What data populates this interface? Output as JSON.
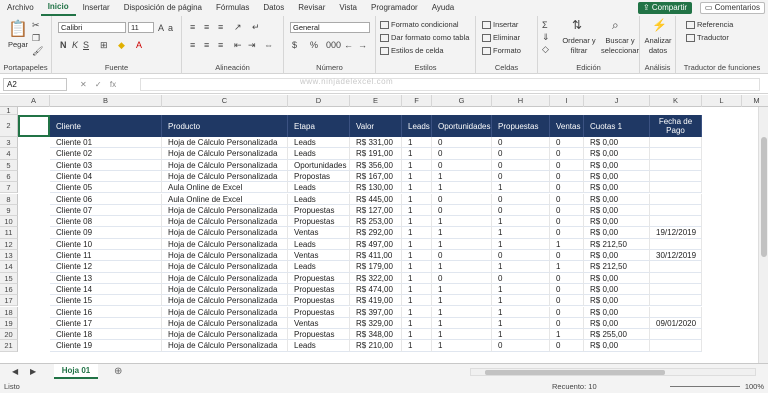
{
  "tabs": [
    "Archivo",
    "Inicio",
    "Insertar",
    "Disposición de página",
    "Fórmulas",
    "Datos",
    "Revisar",
    "Vista",
    "Programador",
    "Ayuda"
  ],
  "active_tab": "Inicio",
  "share_label": "Compartir",
  "comments_label": "Comentarios",
  "ribbon": {
    "clipboard": {
      "paste": "Pegar",
      "label": "Portapapeles"
    },
    "font": {
      "family": "Calibri",
      "size": "11",
      "label": "Fuente"
    },
    "alignment": {
      "label": "Alineación"
    },
    "number": {
      "format": "General",
      "label": "Número"
    },
    "styles": {
      "cond": "Formato condicional",
      "table": "Dar formato como tabla",
      "cell": "Estilos de celda",
      "label": "Estilos"
    },
    "cells": {
      "insert": "Insertar",
      "delete": "Eliminar",
      "format": "Formato",
      "label": "Celdas"
    },
    "editing": {
      "sort": "Ordenar y filtrar",
      "find": "Buscar y seleccionar",
      "label": "Edición"
    },
    "analysis": {
      "analyze": "Analizar datos",
      "label": "Análisis"
    },
    "translator": {
      "ref": "Referencia",
      "trans": "Traductor",
      "label": "Traductor de funciones"
    }
  },
  "name_box": "A2",
  "fx": "✕ ✓ fx",
  "watermark": "www.ninjadelexcel.com",
  "columns": [
    "A",
    "B",
    "C",
    "D",
    "E",
    "F",
    "G",
    "H",
    "I",
    "J",
    "K",
    "L",
    "M"
  ],
  "headers": [
    "Cliente",
    "Producto",
    "Etapa",
    "Valor",
    "Leads",
    "Oportunidades",
    "Propuestas",
    "Ventas",
    "Cuotas 1",
    "Fecha de Pago"
  ],
  "rows": [
    [
      "Cliente 01",
      "Hoja de Cálculo Personalizada",
      "Leads",
      "R$ 331,00",
      "1",
      "0",
      "0",
      "0",
      "R$ 0,00",
      ""
    ],
    [
      "Cliente 02",
      "Hoja de Cálculo Personalizada",
      "Leads",
      "R$ 191,00",
      "1",
      "0",
      "0",
      "0",
      "R$ 0,00",
      ""
    ],
    [
      "Cliente 03",
      "Hoja de Cálculo Personalizada",
      "Oportunidades",
      "R$ 356,00",
      "1",
      "0",
      "0",
      "0",
      "R$ 0,00",
      ""
    ],
    [
      "Cliente 04",
      "Hoja de Cálculo Personalizada",
      "Propostas",
      "R$ 167,00",
      "1",
      "1",
      "0",
      "0",
      "R$ 0,00",
      ""
    ],
    [
      "Cliente 05",
      "Aula Online de Excel",
      "Leads",
      "R$ 130,00",
      "1",
      "1",
      "1",
      "0",
      "R$ 0,00",
      ""
    ],
    [
      "Cliente 06",
      "Aula Online de Excel",
      "Leads",
      "R$ 445,00",
      "1",
      "0",
      "0",
      "0",
      "R$ 0,00",
      ""
    ],
    [
      "Cliente 07",
      "Hoja de Cálculo Personalizada",
      "Propuestas",
      "R$ 127,00",
      "1",
      "0",
      "0",
      "0",
      "R$ 0,00",
      ""
    ],
    [
      "Cliente 08",
      "Hoja de Cálculo Personalizada",
      "Propuestas",
      "R$ 253,00",
      "1",
      "1",
      "1",
      "0",
      "R$ 0,00",
      ""
    ],
    [
      "Cliente 09",
      "Hoja de Cálculo Personalizada",
      "Ventas",
      "R$ 292,00",
      "1",
      "1",
      "1",
      "0",
      "R$ 0,00",
      "19/12/2019"
    ],
    [
      "Cliente 10",
      "Hoja de Cálculo Personalizada",
      "Leads",
      "R$ 497,00",
      "1",
      "1",
      "1",
      "1",
      "R$ 212,50",
      ""
    ],
    [
      "Cliente 11",
      "Hoja de Cálculo Personalizada",
      "Ventas",
      "R$ 411,00",
      "1",
      "0",
      "0",
      "0",
      "R$ 0,00",
      "30/12/2019"
    ],
    [
      "Cliente 12",
      "Hoja de Cálculo Personalizada",
      "Leads",
      "R$ 179,00",
      "1",
      "1",
      "1",
      "1",
      "R$ 212,50",
      ""
    ],
    [
      "Cliente 13",
      "Hoja de Cálculo Personalizada",
      "Propuestas",
      "R$ 322,00",
      "1",
      "0",
      "0",
      "0",
      "R$ 0,00",
      ""
    ],
    [
      "Cliente 14",
      "Hoja de Cálculo Personalizada",
      "Propuestas",
      "R$ 474,00",
      "1",
      "1",
      "1",
      "0",
      "R$ 0,00",
      ""
    ],
    [
      "Cliente 15",
      "Hoja de Cálculo Personalizada",
      "Propuestas",
      "R$ 419,00",
      "1",
      "1",
      "1",
      "0",
      "R$ 0,00",
      ""
    ],
    [
      "Cliente 16",
      "Hoja de Cálculo Personalizada",
      "Propuestas",
      "R$ 397,00",
      "1",
      "1",
      "1",
      "0",
      "R$ 0,00",
      ""
    ],
    [
      "Cliente 17",
      "Hoja de Cálculo Personalizada",
      "Ventas",
      "R$ 329,00",
      "1",
      "1",
      "1",
      "0",
      "R$ 0,00",
      "09/01/2020"
    ],
    [
      "Cliente 18",
      "Hoja de Cálculo Personalizada",
      "Propuestas",
      "R$ 348,00",
      "1",
      "1",
      "1",
      "1",
      "R$ 255,00",
      ""
    ],
    [
      "Cliente 19",
      "Hoja de Cálculo Personalizada",
      "Leads",
      "R$ 210,00",
      "1",
      "1",
      "0",
      "0",
      "R$ 0,00",
      ""
    ]
  ],
  "sheet_tab": "Hoja 01",
  "status": {
    "ready": "Listo",
    "count": "Recuento: 10",
    "zoom": "100%"
  },
  "colors": {
    "header": "#1f3864",
    "accent": "#217346"
  }
}
